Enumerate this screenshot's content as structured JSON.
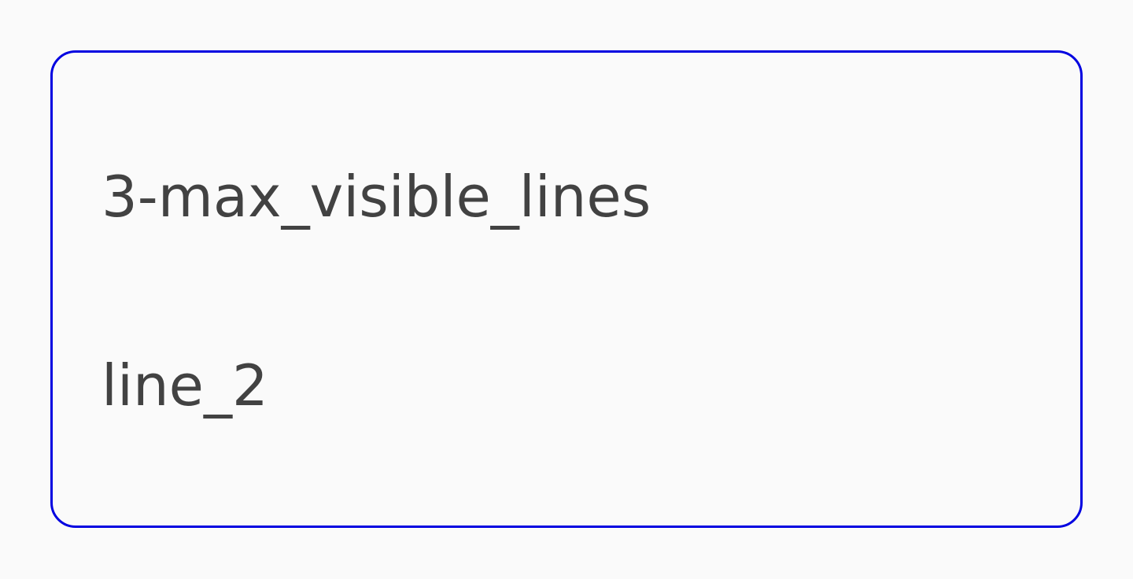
{
  "text_field": {
    "lines": [
      "3-max_visible_lines",
      "line_2"
    ]
  },
  "colors": {
    "background": "#fafafa",
    "border": "#0000e0",
    "text": "#424242"
  }
}
